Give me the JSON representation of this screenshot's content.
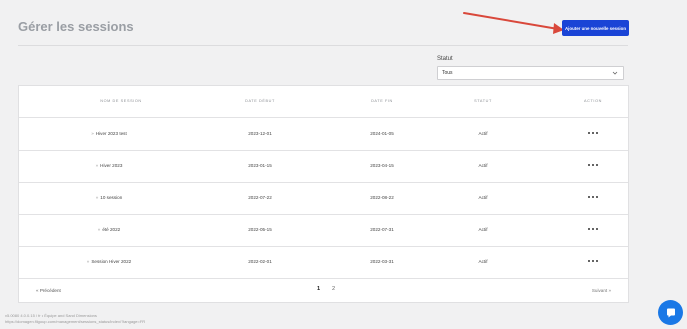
{
  "header": {
    "title": "Gérer les sessions",
    "add_button_label": "Ajouter une nouvelle session"
  },
  "filter": {
    "label": "Statut",
    "selected": "Tous"
  },
  "table": {
    "columns": [
      "NOM DE SESSION",
      "DATE DÉBUT",
      "DATE FIN",
      "STATUT",
      "ACTION"
    ],
    "rows": [
      {
        "name": "Hiver 2023 test",
        "start": "2023-12-01",
        "end": "2024-01-05",
        "status": "Actif"
      },
      {
        "name": "Hiver 2023",
        "start": "2023-01-15",
        "end": "2023-04-15",
        "status": "Actif"
      },
      {
        "name": "10 session",
        "start": "2022-07-22",
        "end": "2022-08-22",
        "status": "Actif"
      },
      {
        "name": "été 2022",
        "start": "2022-05-15",
        "end": "2022-07-31",
        "status": "Actif"
      },
      {
        "name": "Session Hiver 2022",
        "start": "2022-02-01",
        "end": "2022-03-31",
        "status": "Actif"
      }
    ]
  },
  "pagination": {
    "prev": "« Précédent",
    "pages": [
      "1",
      "2"
    ],
    "current": "1",
    "next": "Suivant »"
  },
  "footer": {
    "line1": "v5.0080 4.0.0.15 / fr • Équipe and Sand Dimensions",
    "line2": "https://domagen.fllgoup.com/management/sessions_status/index/?langage=FR"
  },
  "colors": {
    "accent": "#1a44d6",
    "chat": "#1a78e6",
    "arrow": "#d9483b"
  },
  "icons": {
    "select": "chevron-down-icon",
    "action": "more-horizontal-icon",
    "chat": "chat-icon",
    "annotation": "arrow-annotation"
  }
}
